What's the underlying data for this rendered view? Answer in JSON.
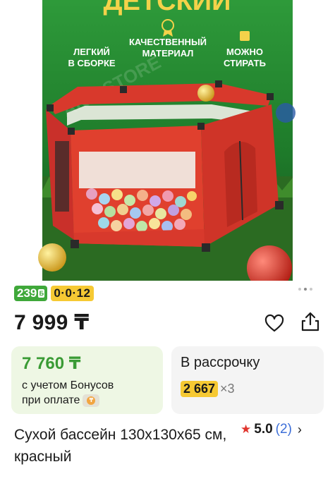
{
  "image": {
    "banner_title": "ДЕТСКИЙ",
    "features": [
      {
        "line1": "ЛЕГКИЙ",
        "line2": "В СБОРКЕ"
      },
      {
        "line1": "КАЧЕСТВЕННЫЙ",
        "line2": "МАТЕРИАЛ"
      },
      {
        "line1": "МОЖНО",
        "line2": "СТИРАТЬ"
      }
    ],
    "watermark": "AKB-STORE",
    "slides_count": 3
  },
  "badges": {
    "bonus": "239",
    "bonus_icon": "Б",
    "installment_plan": "0·0·12"
  },
  "price": {
    "main": "7 999 ₸"
  },
  "bonus_card": {
    "price": "7 760 ₸",
    "line1": "с учетом Бонусов",
    "line2": "при оплате"
  },
  "installment_card": {
    "title": "В рассрочку",
    "amount": "2 667",
    "multiplier": "×3"
  },
  "product": {
    "title": "Сухой бассейн 130х130х65 см, красный",
    "rating": "5.0",
    "reviews": "(2)"
  },
  "colors": {
    "bonus_green": "#3fa83a",
    "plan_yellow": "#f6c933",
    "star_red": "#e0342c",
    "link_blue": "#3d6fd8"
  }
}
